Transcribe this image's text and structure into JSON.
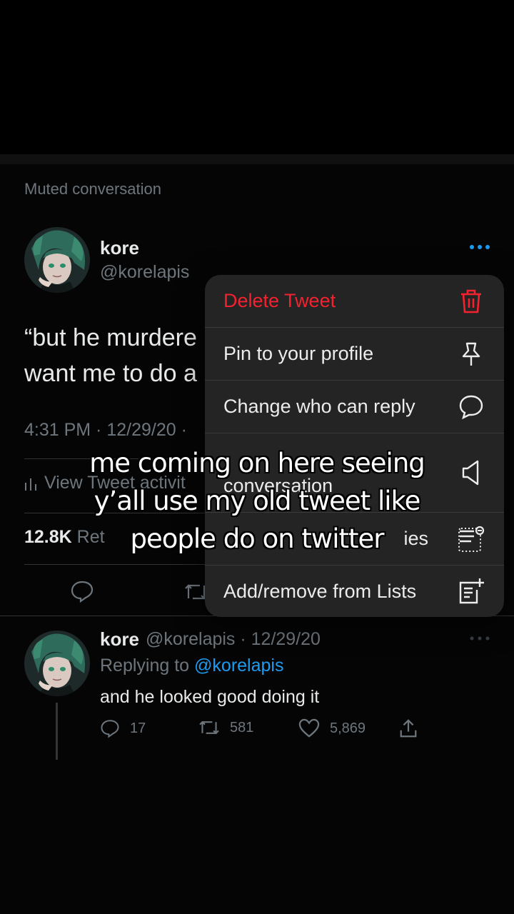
{
  "muted_label": "Muted conversation",
  "tweet": {
    "name": "kore",
    "handle": "@korelapis",
    "text_line1": "“but he murdere",
    "text_line2": "want me to do a",
    "time": "4:31 PM · 12/29/20 ·",
    "activity": "View Tweet activit",
    "retweets_count": "12.8K",
    "retweets_label": "Ret"
  },
  "menu": {
    "items": [
      {
        "label": "Delete Tweet",
        "icon": "trash-icon"
      },
      {
        "label": "Pin to your profile",
        "icon": "pin-icon"
      },
      {
        "label": "Change who can reply",
        "icon": "speech-bubble-icon"
      },
      {
        "label": "conversation",
        "icon": "mute-speaker-icon"
      },
      {
        "label": "ies",
        "icon": "hidden-replies-icon"
      },
      {
        "label": "Add/remove from Lists",
        "icon": "list-add-icon"
      }
    ]
  },
  "caption": {
    "line1": "me coming on here seeing",
    "line2": "y’all use my old tweet like",
    "line3": "people do on twitter"
  },
  "reply": {
    "name": "kore",
    "handle_date": "@korelapis · 12/29/20",
    "replying_prefix": "Replying to",
    "replying_mention": "@korelapis",
    "text": "and he looked good doing it",
    "replies": "17",
    "retweets": "581",
    "likes": "5,869"
  },
  "colors": {
    "accent_blue": "#1d9bf0",
    "danger_red": "#f4212e",
    "muted_gray": "#6e767d"
  }
}
